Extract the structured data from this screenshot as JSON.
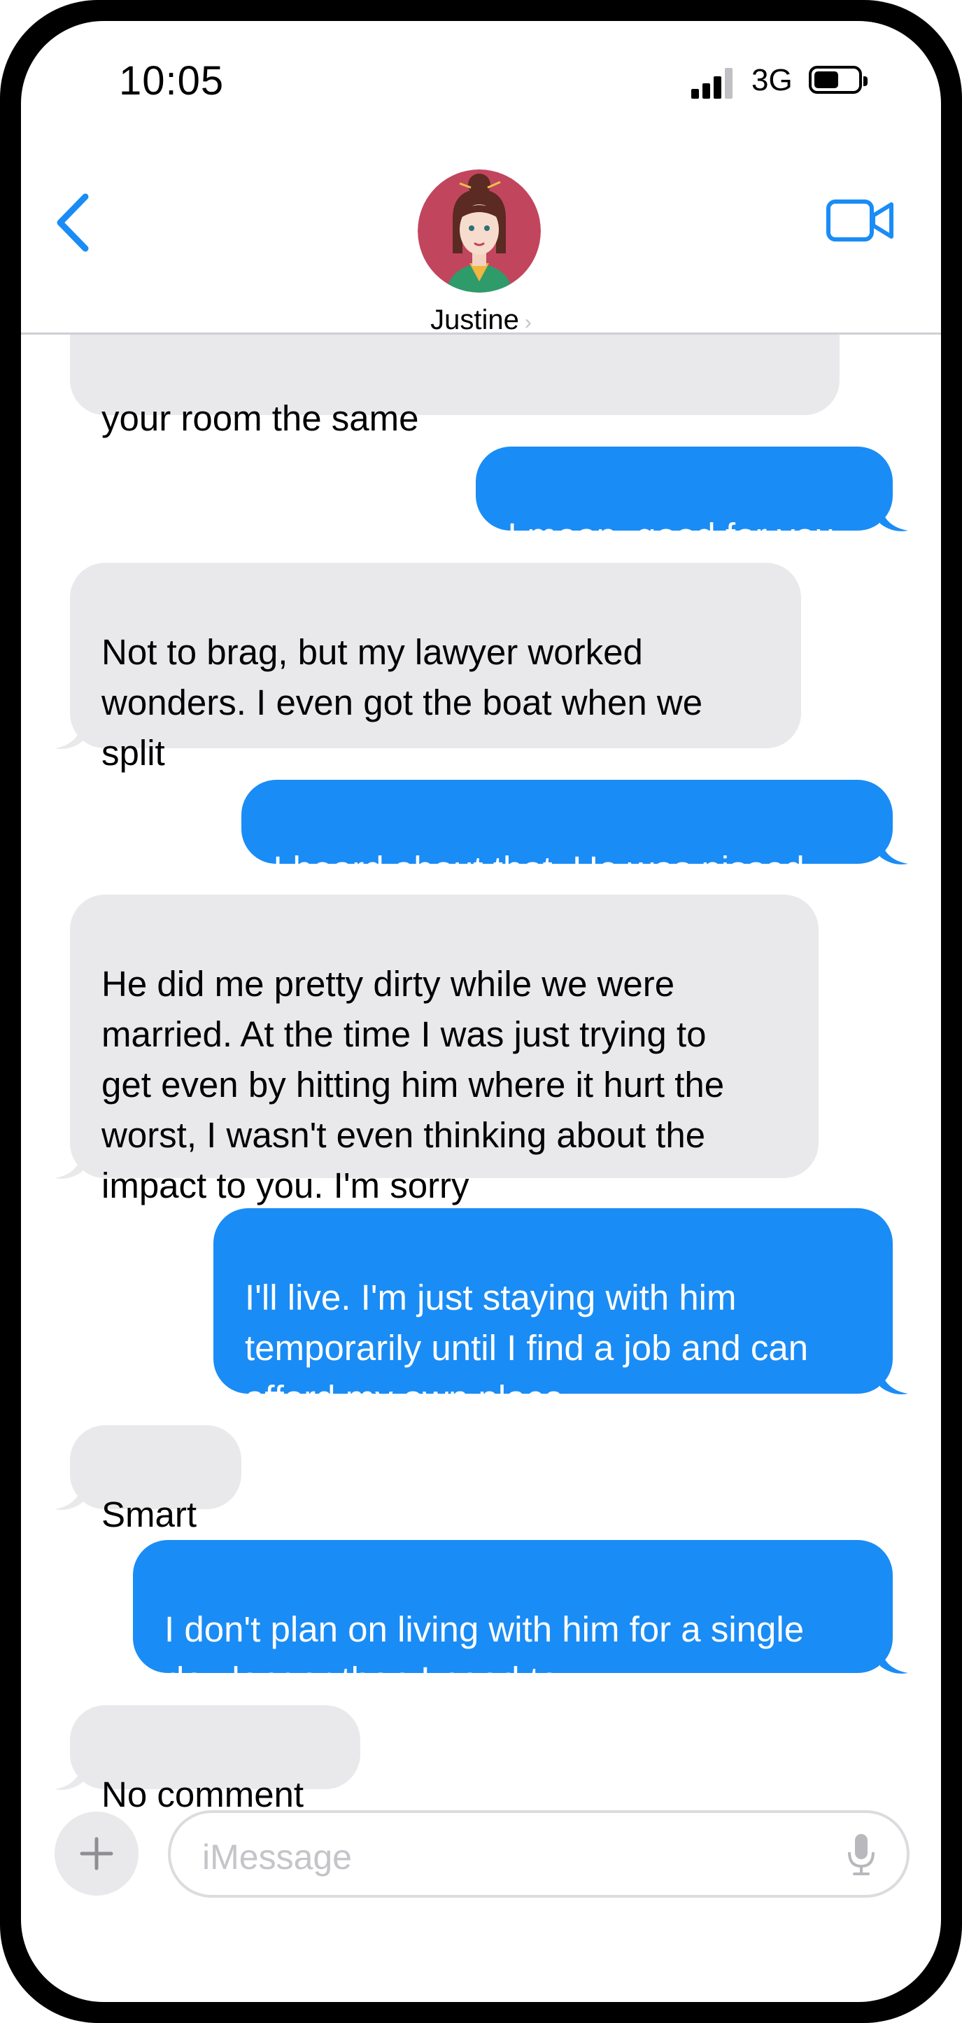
{
  "status_bar": {
    "time": "10:05",
    "network": "3G"
  },
  "header": {
    "contact_name": "Justine"
  },
  "messages": [
    {
      "from": "contact",
      "text": "your room the same"
    },
    {
      "from": "me",
      "text": "I mean, good for you"
    },
    {
      "from": "contact",
      "text": "Not to brag, but my lawyer worked\nwonders.  I even got the boat when we\nsplit"
    },
    {
      "from": "me",
      "text": "I heard about that.  He was pissed"
    },
    {
      "from": "contact",
      "text": "He did me pretty dirty while we were\nmarried.  At the time I was just trying to\nget even by hitting him where it hurt the\nworst, I wasn't even thinking about the\nimpact to you.  I'm sorry"
    },
    {
      "from": "me",
      "text": "I'll live.  I'm just staying with him\ntemporarily until I find a job and can\nafford my own place"
    },
    {
      "from": "contact",
      "text": "Smart"
    },
    {
      "from": "me",
      "text": "I don't plan on living with him for a single\nday longer than I need to"
    },
    {
      "from": "contact",
      "text": "No comment"
    }
  ],
  "input": {
    "placeholder": "iMessage"
  },
  "colors": {
    "sent_bubble": "#1a8cf5",
    "received_bubble": "#e9e9eb",
    "accent": "#1a8cf5"
  }
}
